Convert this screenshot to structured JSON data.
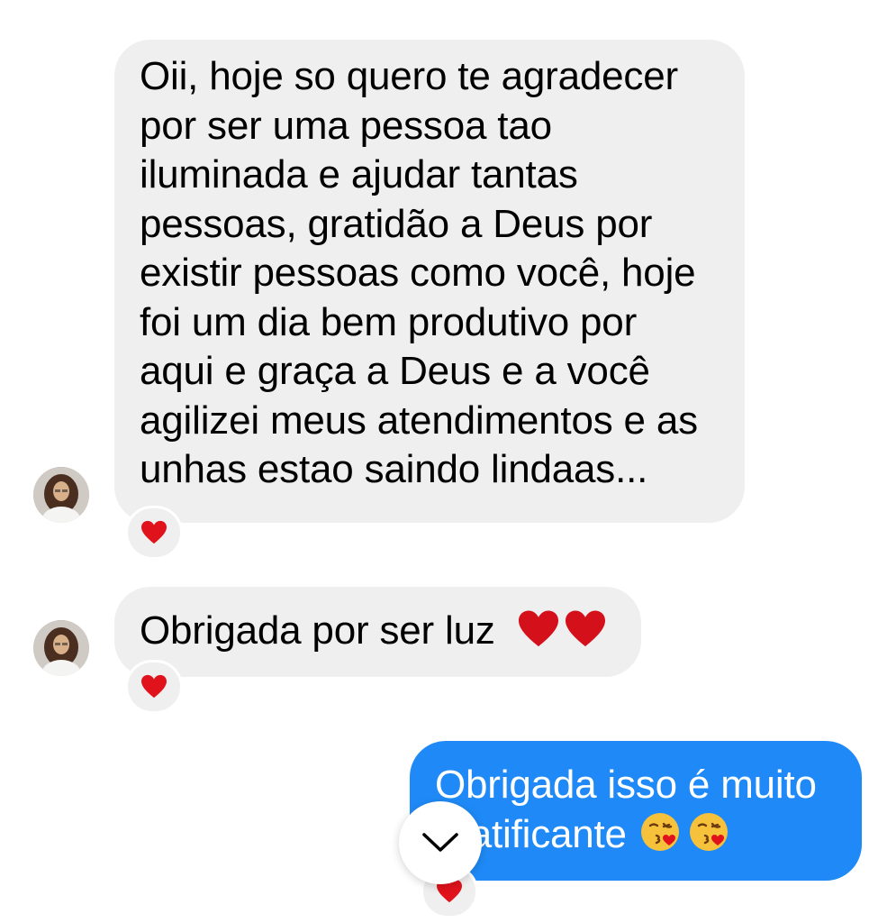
{
  "messages": [
    {
      "direction": "incoming",
      "lines": [
        "Oii, hoje so quero te agradecer",
        "por ser uma pessoa tao",
        "iluminada e ajudar tantas",
        "pessoas, gratidão a Deus por",
        "existir pessoas como você, hoje",
        "foi um dia bem produtivo por",
        "aqui e graça a Deus e a você",
        "agilizei meus atendimentos e as",
        "unhas estao saindo lindaas..."
      ],
      "reaction": "heart-icon"
    },
    {
      "direction": "incoming",
      "text": "Obrigada por ser luz",
      "emoji": [
        "heart-icon",
        "heart-icon"
      ],
      "reaction": "heart-icon"
    },
    {
      "direction": "outgoing",
      "lines": [
        "Obrigada isso é muito",
        "gratificante"
      ],
      "emoji": [
        "face-blowing-kiss-icon",
        "face-blowing-kiss-icon"
      ],
      "reaction": "heart-icon"
    }
  ],
  "colors": {
    "incoming_bubble": "#efeff0",
    "outgoing_bubble": "#1f8af7",
    "heart": "#e0121b"
  },
  "icons": {
    "scroll_button": "chevron-down-icon",
    "avatar": "contact-avatar"
  }
}
